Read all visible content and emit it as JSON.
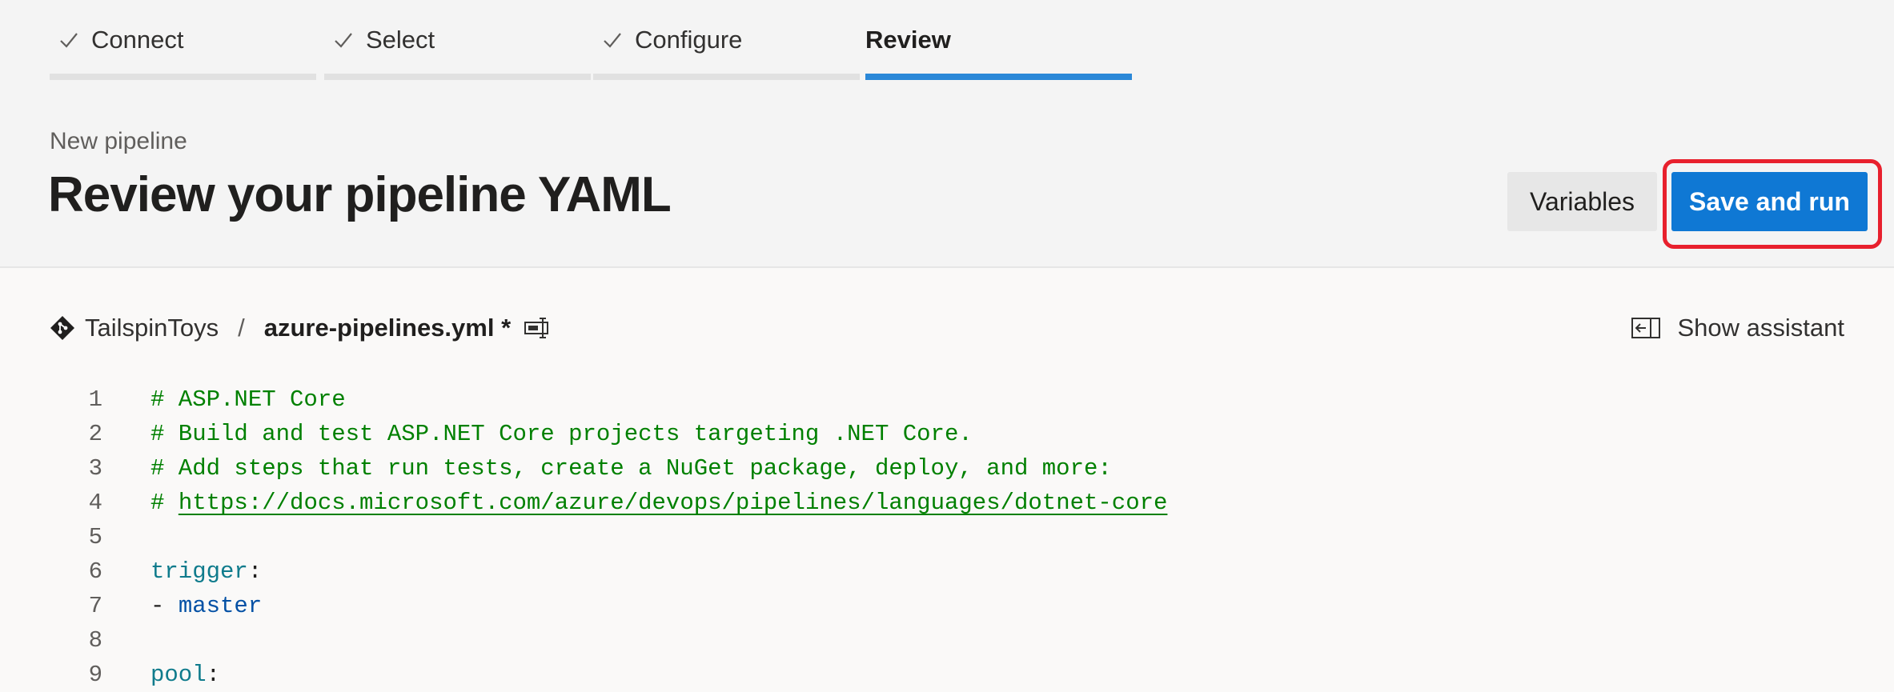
{
  "wizard": {
    "steps": [
      {
        "label": "Connect",
        "done": true
      },
      {
        "label": "Select",
        "done": true
      },
      {
        "label": "Configure",
        "done": true
      },
      {
        "label": "Review",
        "done": false,
        "active": true
      }
    ]
  },
  "header": {
    "subtitle": "New pipeline",
    "title": "Review your pipeline YAML",
    "variables_label": "Variables",
    "save_label": "Save and run"
  },
  "file": {
    "repo": "TailspinToys",
    "separator": "/",
    "filename": "azure-pipelines.yml *",
    "show_assistant_label": "Show assistant"
  },
  "editor": {
    "lines": [
      {
        "num": "1",
        "comment": "# ASP.NET Core"
      },
      {
        "num": "2",
        "comment": "# Build and test ASP.NET Core projects targeting .NET Core."
      },
      {
        "num": "3",
        "comment": "# Add steps that run tests, create a NuGet package, deploy, and more:"
      },
      {
        "num": "4",
        "comment_prefix": "# ",
        "link": "https://docs.microsoft.com/azure/devops/pipelines/languages/dotnet-core"
      },
      {
        "num": "5"
      },
      {
        "num": "6",
        "key": "trigger",
        "punct": ":"
      },
      {
        "num": "7",
        "punct": "- ",
        "value": "master"
      },
      {
        "num": "8"
      },
      {
        "num": "9",
        "key": "pool",
        "punct": ":"
      }
    ]
  },
  "colors": {
    "accent": "#0f78d4",
    "active_step": "#2b88d8",
    "highlight": "#e8202d",
    "comment": "#008000",
    "key": "#0f7b8c",
    "value": "#0451a5"
  }
}
